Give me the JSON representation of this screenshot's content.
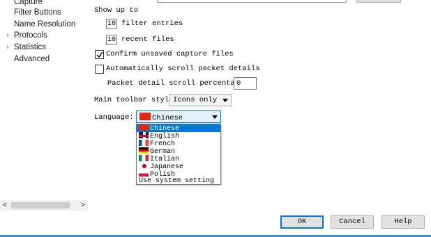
{
  "nav": {
    "items": [
      {
        "label": "Capture",
        "expandable": false
      },
      {
        "label": "Filter Buttons",
        "expandable": false
      },
      {
        "label": "Name Resolution",
        "expandable": false
      },
      {
        "label": "Protocols",
        "expandable": true,
        "arrow": "›"
      },
      {
        "label": "Statistics",
        "expandable": true,
        "arrow": "›"
      },
      {
        "label": "Advanced",
        "expandable": false
      }
    ],
    "scroll_left": "<",
    "scroll_right": ">"
  },
  "prefs": {
    "show_up_to": "Show up to",
    "filter_entries_value": "10",
    "filter_entries_label": "filter entries",
    "recent_files_value": "10",
    "recent_files_label": "recent files",
    "confirm_unsaved_label": "Confirm unsaved capture files",
    "confirm_unsaved_checked": true,
    "auto_scroll_label": "Automatically scroll packet details",
    "auto_scroll_checked": false,
    "scroll_pct_label": "Packet detail scroll percentage:",
    "scroll_pct_value": "0",
    "toolbar_style_label": "Main toolbar style:",
    "toolbar_style_value": "Icons only",
    "language_label": "Language:",
    "language_value": "Chinese",
    "language_options": [
      {
        "label": "Chinese",
        "flag": "flag-cn",
        "selected": true
      },
      {
        "label": "English",
        "flag": "flag-gb",
        "selected": false
      },
      {
        "label": "French",
        "flag": "flag-fr",
        "selected": false
      },
      {
        "label": "German",
        "flag": "flag-de",
        "selected": false
      },
      {
        "label": "Italian",
        "flag": "flag-it",
        "selected": false
      },
      {
        "label": "Japanese",
        "flag": "flag-jp",
        "selected": false
      },
      {
        "label": "Polish",
        "flag": "flag-pl",
        "selected": false
      },
      {
        "label": "Use system setting",
        "flag": "",
        "selected": false
      }
    ]
  },
  "buttons": {
    "ok": "OK",
    "cancel": "Cancel",
    "help": "Help"
  },
  "colors": {
    "accent": "#0078d7",
    "bottom_bar": "#3c8fd0"
  }
}
